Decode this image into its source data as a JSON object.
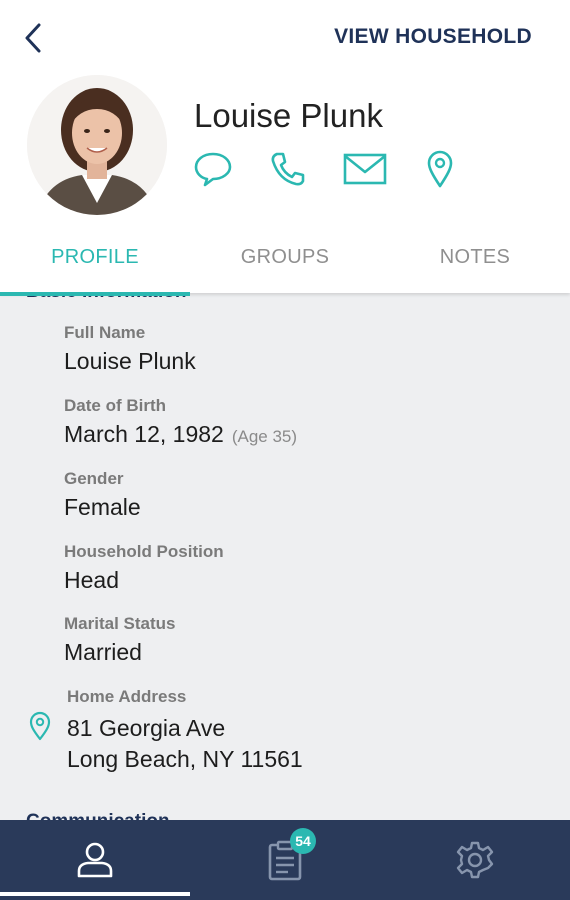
{
  "header": {
    "back_icon": "chevron-left-icon",
    "view_household_label": "VIEW HOUSEHOLD"
  },
  "profile": {
    "name": "Louise Plunk",
    "actions": [
      "chat-icon",
      "phone-icon",
      "mail-icon",
      "location-pin-icon"
    ]
  },
  "tabs": [
    {
      "label": "PROFILE",
      "active": true
    },
    {
      "label": "GROUPS",
      "active": false
    },
    {
      "label": "NOTES",
      "active": false
    }
  ],
  "basic_info": {
    "section_title": "Basic Information",
    "full_name_label": "Full Name",
    "full_name": "Louise Plunk",
    "dob_label": "Date of Birth",
    "dob": "March 12, 1982",
    "age": "(Age 35)",
    "gender_label": "Gender",
    "gender": "Female",
    "household_position_label": "Household Position",
    "household_position": "Head",
    "marital_status_label": "Marital Status",
    "marital_status": "Married",
    "home_address_label": "Home Address",
    "address_line1": "81 Georgia Ave",
    "address_line2": "Long Beach, NY 11561"
  },
  "next_section_title": "Communication",
  "bottom_nav": {
    "items": [
      "person-icon",
      "clipboard-icon",
      "gear-icon"
    ],
    "badge_count": "54"
  },
  "colors": {
    "accent": "#2bb8b1",
    "navy": "#1f3258",
    "nav_bg": "#2a3a5a",
    "content_bg": "#eeeff1"
  }
}
